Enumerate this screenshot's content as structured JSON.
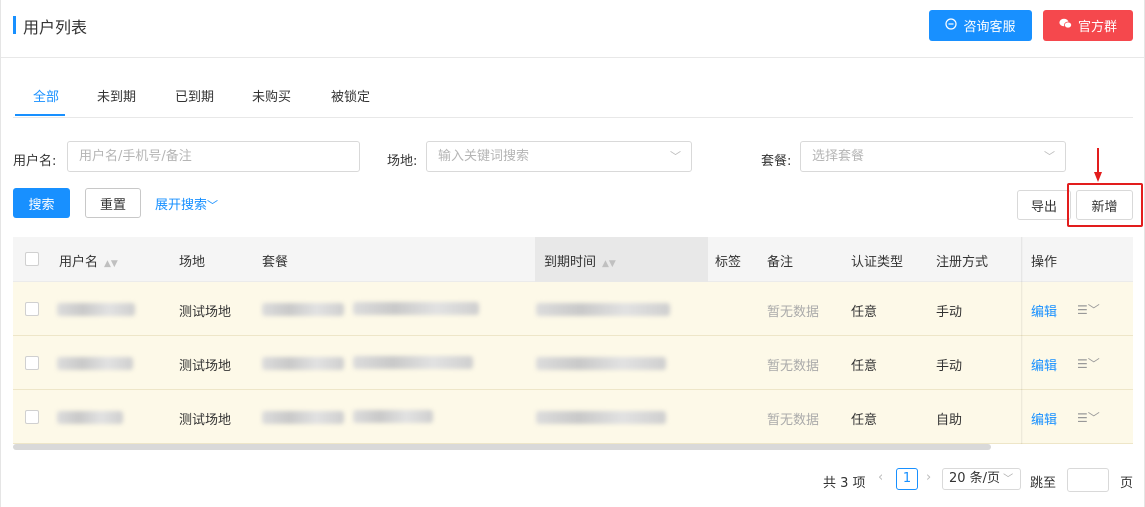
{
  "header": {
    "title": "用户列表",
    "consult_label": "咨询客服",
    "official_label": "官方群"
  },
  "tabs": [
    "全部",
    "未到期",
    "已到期",
    "未购买",
    "被锁定"
  ],
  "filters": {
    "user_label": "用户名:",
    "user_placeholder": "用户名/手机号/备注",
    "venue_label": "场地:",
    "venue_placeholder": "输入关键词搜索",
    "package_label": "套餐:",
    "package_placeholder": "选择套餐"
  },
  "actions": {
    "search": "搜索",
    "reset": "重置",
    "expand": "展开搜索",
    "export": "导出",
    "add": "新增"
  },
  "table": {
    "columns": [
      "用户名",
      "场地",
      "套餐",
      "到期时间",
      "标签",
      "备注",
      "认证类型",
      "注册方式",
      "操作"
    ],
    "rows": [
      {
        "venue": "测试场地",
        "note": "暂无数据",
        "auth": "任意",
        "register": "手动",
        "edit": "编辑"
      },
      {
        "venue": "测试场地",
        "note": "暂无数据",
        "auth": "任意",
        "register": "手动",
        "edit": "编辑"
      },
      {
        "venue": "测试场地",
        "note": "暂无数据",
        "auth": "任意",
        "register": "自助",
        "edit": "编辑"
      }
    ]
  },
  "pagination": {
    "total": "共 3 项",
    "current": "1",
    "page_size": "20 条/页",
    "jump": "跳至",
    "page_unit": "页"
  },
  "colors": {
    "primary": "#1890ff",
    "danger": "#f5484d",
    "row_highlight": "#fdf9e8",
    "annotation_red": "#e21d1d"
  }
}
